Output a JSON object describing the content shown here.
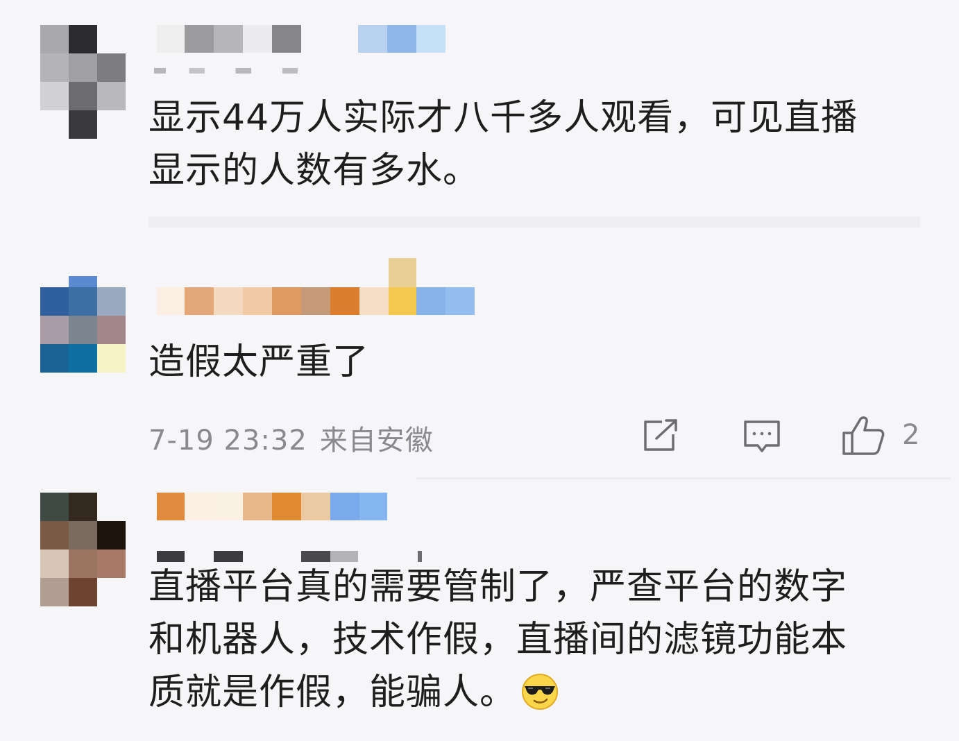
{
  "comments": [
    {
      "text": "显示44万人实际才八千多人观看，可见直播显示的人数有多水。",
      "line1": "显示44万人实际才八千多人观看，可见直播",
      "line2": "显示的人数有多水。"
    },
    {
      "text": "造假太严重了",
      "time": "7-19 23:32",
      "location": "来自安徽",
      "like_count": "2"
    },
    {
      "line1": "直播平台真的需要管制了，严查平台的数字",
      "line2": "和机器人，技术作假，直播间的滤镜功能本",
      "line3": "质就是作假，能骗人。",
      "emoji": "cool-sunglasses-emoji"
    }
  ],
  "icons": {
    "share": "share-icon",
    "reply": "comment-icon",
    "like": "thumbs-up-icon"
  },
  "colors": {
    "background": "#f6f6f8",
    "text": "#1e1e1e",
    "meta": "#8a8a8e"
  }
}
